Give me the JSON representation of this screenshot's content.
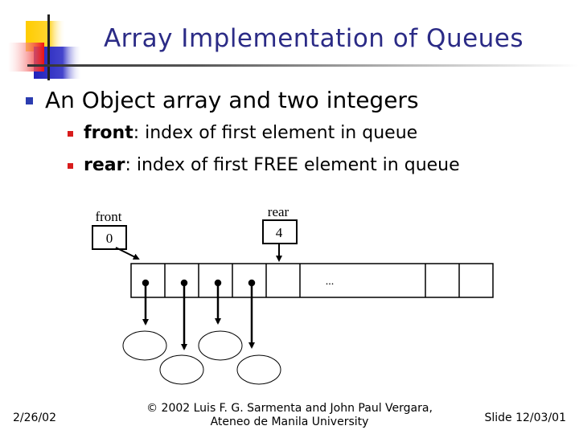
{
  "slide": {
    "title": "Array Implementation of Queues",
    "bullets": [
      {
        "text": "An Object array and two integers",
        "sub": [
          {
            "bold": "front",
            "text": ": index of first element in queue"
          },
          {
            "bold": "rear",
            "text": ": index of first FREE element in queue"
          }
        ]
      }
    ]
  },
  "diagram": {
    "front": {
      "label": "front",
      "value": "0"
    },
    "rear": {
      "label": "rear",
      "value": "4"
    },
    "array": {
      "filled_cells": 4,
      "ellipsis": "..."
    }
  },
  "footer": {
    "date": "2/26/02",
    "copyright_line1": "© 2002 Luis F. G. Sarmenta and John Paul Vergara,",
    "copyright_line2": "Ateneo de Manila University",
    "slide_number": "Slide 12/03/01"
  },
  "colors": {
    "title": "#2b2b86",
    "bullet_primary": "#2b3cb0",
    "bullet_secondary": "#d81c1c"
  }
}
